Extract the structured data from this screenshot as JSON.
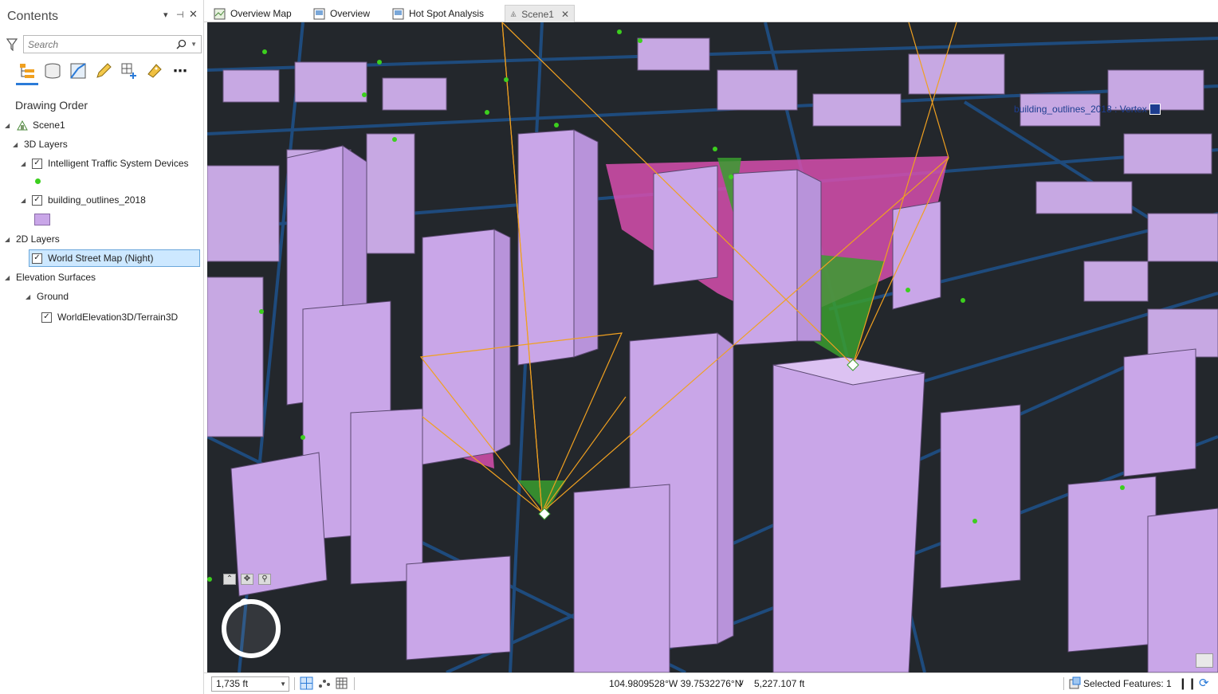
{
  "contents": {
    "title": "Contents",
    "search_placeholder": "Search",
    "drawing_order_heading": "Drawing Order",
    "tree": {
      "scene": "Scene1",
      "layers3d": "3D Layers",
      "its": "Intelligent Traffic System Devices",
      "buildings": "building_outlines_2018",
      "layers2d": "2D Layers",
      "basemap": "World Street Map (Night)",
      "elevation": "Elevation Surfaces",
      "ground": "Ground",
      "terrain": "WorldElevation3D/Terrain3D"
    }
  },
  "tabs": [
    {
      "label": "Overview Map",
      "icon": "map-icon"
    },
    {
      "label": "Overview",
      "icon": "layout-icon"
    },
    {
      "label": "Hot Spot Analysis",
      "icon": "layout-icon"
    },
    {
      "label": "Scene1",
      "icon": "scene-icon"
    }
  ],
  "map": {
    "vertex_label": "building_outlines_2018 : Vertex"
  },
  "status": {
    "scale": "1,735 ft",
    "coordinates": "104.9809528°W 39.7532276°N",
    "elevation": "5,227.107 ft",
    "selected_features": "Selected Features: 1"
  },
  "colors": {
    "building": "#c9a6e8",
    "viewshed_visible": "#3a9d2f",
    "viewshed_hidden": "#d64fae",
    "frustum": "#f0a020",
    "roads": "#1e4f86",
    "selection": "#cde8ff"
  }
}
